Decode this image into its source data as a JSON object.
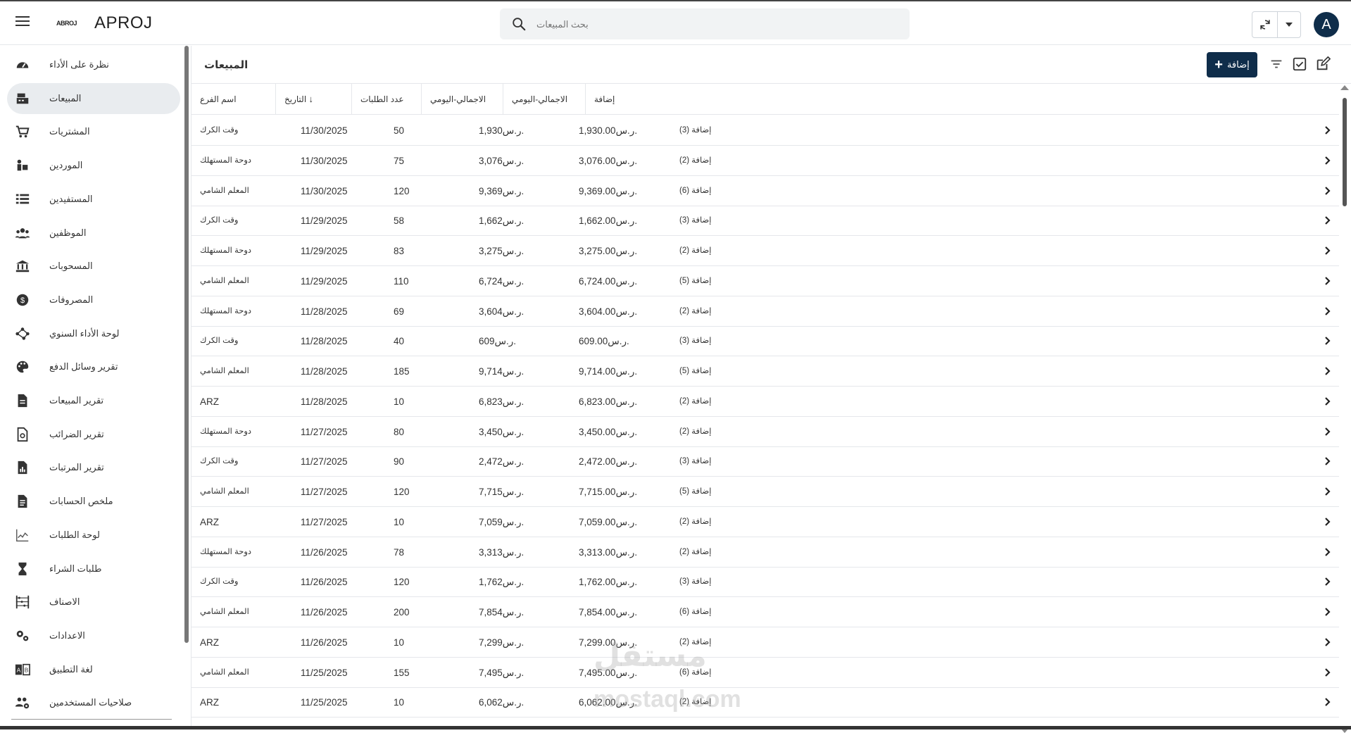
{
  "app": {
    "title": "APROJ",
    "logo_text": "ABROJ"
  },
  "search": {
    "placeholder": "بحث المبيعات"
  },
  "user": {
    "avatar_letter": "A"
  },
  "sidebar": {
    "items": [
      {
        "label": "نظرة على الأداء",
        "icon": "speedometer-icon"
      },
      {
        "label": "المبيعات",
        "icon": "cash-register-icon",
        "active": true
      },
      {
        "label": "المشتريات",
        "icon": "cart-icon"
      },
      {
        "label": "الموردين",
        "icon": "supplier-icon"
      },
      {
        "label": "المستفيدين",
        "icon": "list-icon"
      },
      {
        "label": "الموظفين",
        "icon": "people-icon"
      },
      {
        "label": "المسحوبات",
        "icon": "bank-icon"
      },
      {
        "label": "المصروفات",
        "icon": "coin-icon"
      },
      {
        "label": "لوحة الأداء السنوي",
        "icon": "network-icon"
      },
      {
        "label": "تقرير وسائل الدفع",
        "icon": "palette-icon"
      },
      {
        "label": "تقرير المبيعات",
        "icon": "document-icon"
      },
      {
        "label": "تقرير الضرائب",
        "icon": "tax-document-icon"
      },
      {
        "label": "تقرير المرتبات",
        "icon": "chart-document-icon"
      },
      {
        "label": "ملخص الحسابات",
        "icon": "summary-document-icon"
      },
      {
        "label": "لوحة الطلبات",
        "icon": "line-chart-icon"
      },
      {
        "label": "طلبات الشراء",
        "icon": "hourglass-icon"
      },
      {
        "label": "الاصناف",
        "icon": "abacus-icon"
      },
      {
        "label": "الاعدادات",
        "icon": "gears-icon"
      },
      {
        "label": "لغة التطبيق",
        "icon": "language-icon"
      },
      {
        "label": "صلاحيات المستخدمين",
        "icon": "users-gear-icon"
      }
    ]
  },
  "main": {
    "title": "المبيعات",
    "add_label": "إضافة",
    "columns": [
      "اسم الفرع",
      "التاريخ",
      "عدد الطلبات",
      "الاجمالي-اليومي",
      "الاجمالي-اليومي",
      "إضافة"
    ],
    "rows": [
      {
        "branch": "وقت الكرك",
        "date": "11/30/2025",
        "orders": "50",
        "total_short": "1,930ر.س.",
        "total_full": "1,930.00ر.س.",
        "extra": "إضافة (3)"
      },
      {
        "branch": "دوحة المستهلك",
        "date": "11/30/2025",
        "orders": "75",
        "total_short": "3,076ر.س.",
        "total_full": "3,076.00ر.س.",
        "extra": "إضافة (2)"
      },
      {
        "branch": "المعلم الشامي",
        "date": "11/30/2025",
        "orders": "120",
        "total_short": "9,369ر.س.",
        "total_full": "9,369.00ر.س.",
        "extra": "إضافة (6)"
      },
      {
        "branch": "وقت الكرك",
        "date": "11/29/2025",
        "orders": "58",
        "total_short": "1,662ر.س.",
        "total_full": "1,662.00ر.س.",
        "extra": "إضافة (3)"
      },
      {
        "branch": "دوحة المستهلك",
        "date": "11/29/2025",
        "orders": "83",
        "total_short": "3,275ر.س.",
        "total_full": "3,275.00ر.س.",
        "extra": "إضافة (2)"
      },
      {
        "branch": "المعلم الشامي",
        "date": "11/29/2025",
        "orders": "110",
        "total_short": "6,724ر.س.",
        "total_full": "6,724.00ر.س.",
        "extra": "إضافة (5)"
      },
      {
        "branch": "دوحة المستهلك",
        "date": "11/28/2025",
        "orders": "69",
        "total_short": "3,604ر.س.",
        "total_full": "3,604.00ر.س.",
        "extra": "إضافة (2)"
      },
      {
        "branch": "وقت الكرك",
        "date": "11/28/2025",
        "orders": "40",
        "total_short": "609ر.س.",
        "total_full": "609.00ر.س.",
        "extra": "إضافة (3)"
      },
      {
        "branch": "المعلم الشامي",
        "date": "11/28/2025",
        "orders": "185",
        "total_short": "9,714ر.س.",
        "total_full": "9,714.00ر.س.",
        "extra": "إضافة (5)"
      },
      {
        "branch": "ARZ",
        "date": "11/28/2025",
        "orders": "10",
        "total_short": "6,823ر.س.",
        "total_full": "6,823.00ر.س.",
        "extra": "إضافة (2)"
      },
      {
        "branch": "دوحة المستهلك",
        "date": "11/27/2025",
        "orders": "80",
        "total_short": "3,450ر.س.",
        "total_full": "3,450.00ر.س.",
        "extra": "إضافة (2)"
      },
      {
        "branch": "وقت الكرك",
        "date": "11/27/2025",
        "orders": "90",
        "total_short": "2,472ر.س.",
        "total_full": "2,472.00ر.س.",
        "extra": "إضافة (3)"
      },
      {
        "branch": "المعلم الشامي",
        "date": "11/27/2025",
        "orders": "120",
        "total_short": "7,715ر.س.",
        "total_full": "7,715.00ر.س.",
        "extra": "إضافة (5)"
      },
      {
        "branch": "ARZ",
        "date": "11/27/2025",
        "orders": "10",
        "total_short": "7,059ر.س.",
        "total_full": "7,059.00ر.س.",
        "extra": "إضافة (2)"
      },
      {
        "branch": "دوحة المستهلك",
        "date": "11/26/2025",
        "orders": "78",
        "total_short": "3,313ر.س.",
        "total_full": "3,313.00ر.س.",
        "extra": "إضافة (2)"
      },
      {
        "branch": "وقت الكرك",
        "date": "11/26/2025",
        "orders": "120",
        "total_short": "1,762ر.س.",
        "total_full": "1,762.00ر.س.",
        "extra": "إضافة (3)"
      },
      {
        "branch": "المعلم الشامي",
        "date": "11/26/2025",
        "orders": "200",
        "total_short": "7,854ر.س.",
        "total_full": "7,854.00ر.س.",
        "extra": "إضافة (6)"
      },
      {
        "branch": "ARZ",
        "date": "11/26/2025",
        "orders": "10",
        "total_short": "7,299ر.س.",
        "total_full": "7,299.00ر.س.",
        "extra": "إضافة (2)"
      },
      {
        "branch": "المعلم الشامي",
        "date": "11/25/2025",
        "orders": "155",
        "total_short": "7,495ر.س.",
        "total_full": "7,495.00ر.س.",
        "extra": "إضافة (6)"
      },
      {
        "branch": "ARZ",
        "date": "11/25/2025",
        "orders": "10",
        "total_short": "6,062ر.س.",
        "total_full": "6,062.00ر.س.",
        "extra": "إضافة (2)"
      }
    ]
  },
  "watermark": {
    "line1": "مستقل",
    "line2": "mostaql.com"
  },
  "colors": {
    "primary": "#0f2d4a",
    "active_bg": "#e9ecef",
    "border": "#e5e7eb"
  }
}
